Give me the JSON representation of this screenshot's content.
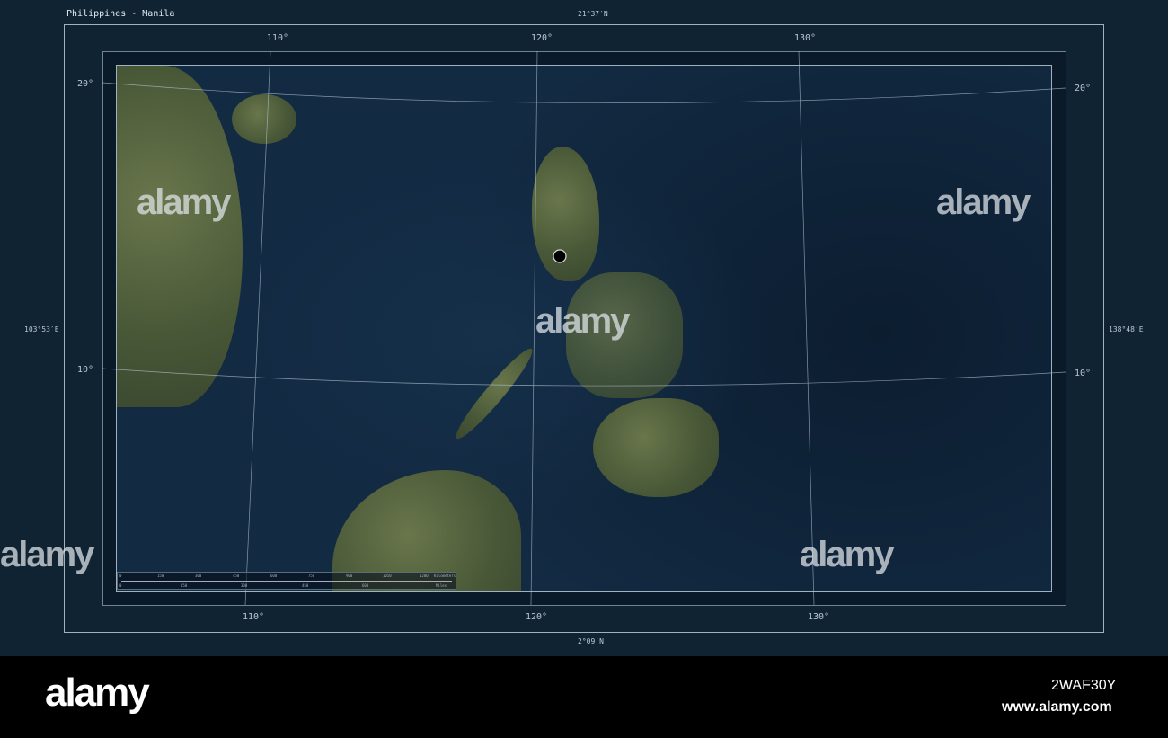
{
  "title": "Philippines - Manila",
  "bounds": {
    "north": "21°37′N",
    "south": "2°09′N",
    "west": "103°53′E",
    "east": "138°48′E"
  },
  "graticule": {
    "lon": [
      "110°",
      "120°",
      "130°"
    ],
    "lat": [
      "20°",
      "10°"
    ]
  },
  "marker": {
    "name": "Manila"
  },
  "scale_bar": {
    "km_ticks": [
      "0",
      "150",
      "300",
      "450",
      "600",
      "750",
      "900",
      "1050",
      "1200"
    ],
    "km_unit": "Kilometers",
    "mi_ticks": [
      "0",
      "150",
      "300",
      "450",
      "600"
    ],
    "mi_unit": "Miles"
  },
  "watermark": {
    "brand": "alamy",
    "site": "www.alamy.com",
    "image_code": "2WAF30Y"
  },
  "colors": {
    "frame": "#0f2333",
    "ocean": "#122a42",
    "land": "#5b6a3e",
    "marker": "#000000"
  }
}
